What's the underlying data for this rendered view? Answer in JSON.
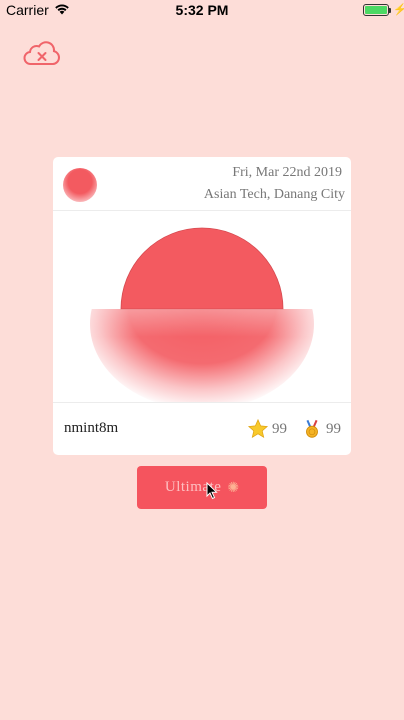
{
  "status_bar": {
    "carrier": "Carrier",
    "time": "5:32 PM",
    "battery_level": 1.0,
    "battery_color": "#4cd964"
  },
  "toolbar": {
    "cloud_icon": "cloud-x-icon"
  },
  "card": {
    "date": "Fri, Mar 22nd 2019",
    "location": "Asian Tech, Danang City",
    "username": "nmint8m",
    "stars": "99",
    "medals": "99",
    "accent_color": "#f35a60"
  },
  "actions": {
    "ultimate_label": "Ultimate"
  },
  "colors": {
    "background": "#fdddd8",
    "button": "#f5545e"
  }
}
